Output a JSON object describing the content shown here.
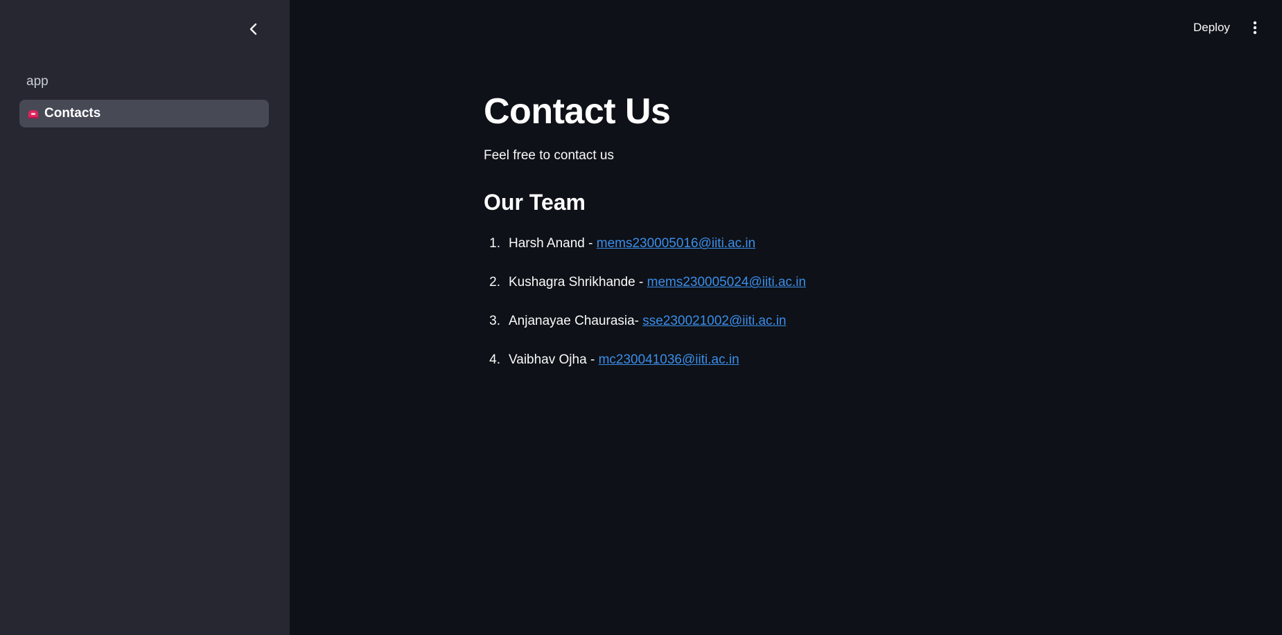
{
  "sidebar": {
    "collapse_icon": "chevron-left-icon",
    "items": [
      {
        "label": "app",
        "active": false
      },
      {
        "label": "Contacts",
        "active": true,
        "icon": "flag-emoji-icon"
      }
    ]
  },
  "header": {
    "deploy_label": "Deploy",
    "menu_icon": "vertical-dots-icon"
  },
  "main": {
    "title": "Contact Us",
    "intro": "Feel free to contact us",
    "team_heading": "Our Team",
    "team": [
      {
        "num": "1.",
        "name": "Harsh Anand - ",
        "email": "mems230005016@iiti.ac.in"
      },
      {
        "num": "2.",
        "name": "Kushagra Shrikhande - ",
        "email": "mems230005024@iiti.ac.in"
      },
      {
        "num": "3.",
        "name": "Anjanayae Chaurasia- ",
        "email": "sse230021002@iiti.ac.in"
      },
      {
        "num": "4.",
        "name": "Vaibhav Ojha - ",
        "email": "mc230041036@iiti.ac.in"
      }
    ]
  },
  "colors": {
    "background": "#0e1117",
    "sidebar": "#262730",
    "active_item": "#474955",
    "link": "#3b8eea"
  }
}
